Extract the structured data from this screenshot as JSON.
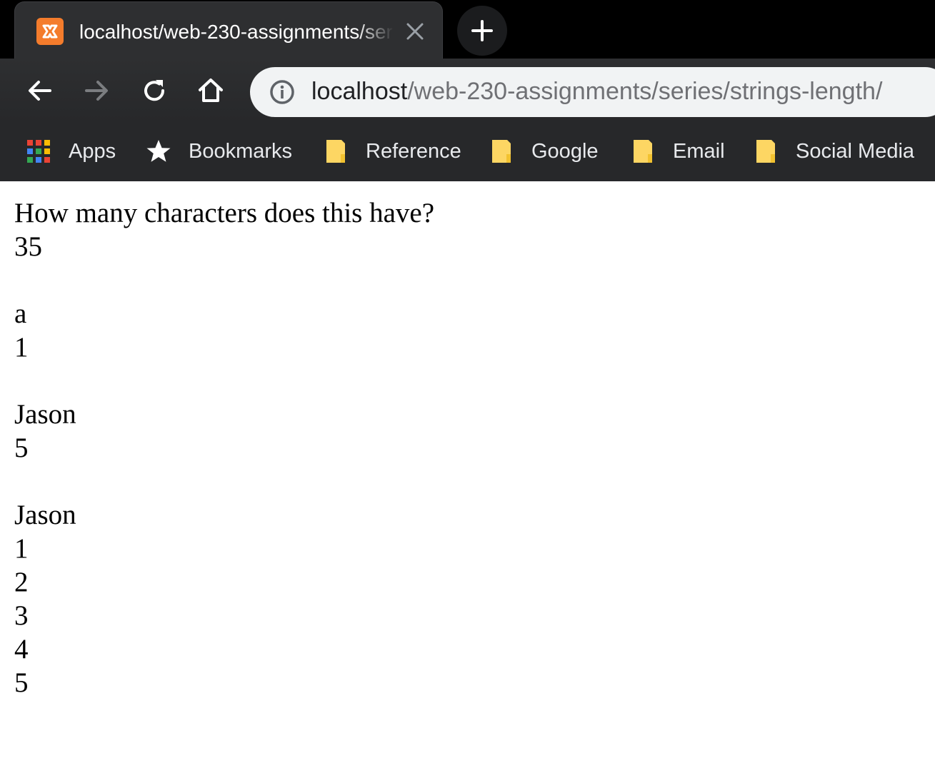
{
  "browser": {
    "tab": {
      "title": "localhost/web-230-assignments/series/strings-length/",
      "favicon": "xampp-icon"
    },
    "toolbar": {
      "url_host": "localhost",
      "url_path": "/web-230-assignments/series/strings-length/"
    },
    "bookmarks": [
      {
        "label": "Apps",
        "icon": "apps-grid-icon"
      },
      {
        "label": "Bookmarks",
        "icon": "star-icon"
      },
      {
        "label": "Reference",
        "icon": "folder-icon"
      },
      {
        "label": "Google",
        "icon": "folder-icon"
      },
      {
        "label": "Email",
        "icon": "folder-icon"
      },
      {
        "label": "Social Media",
        "icon": "folder-icon"
      }
    ],
    "colors": {
      "tab_active": "#2e2f31",
      "omnibox": "#f1f3f4",
      "folder": "#fdd663",
      "favicon": "#f47c2c"
    }
  },
  "page": {
    "blocks": [
      {
        "lines": [
          "How many characters does this have?",
          "35"
        ]
      },
      {
        "lines": [
          "a",
          "1"
        ]
      },
      {
        "lines": [
          "Jason",
          "5"
        ]
      },
      {
        "lines": [
          "Jason",
          "1",
          "2",
          "3",
          "4",
          "5"
        ]
      }
    ]
  }
}
